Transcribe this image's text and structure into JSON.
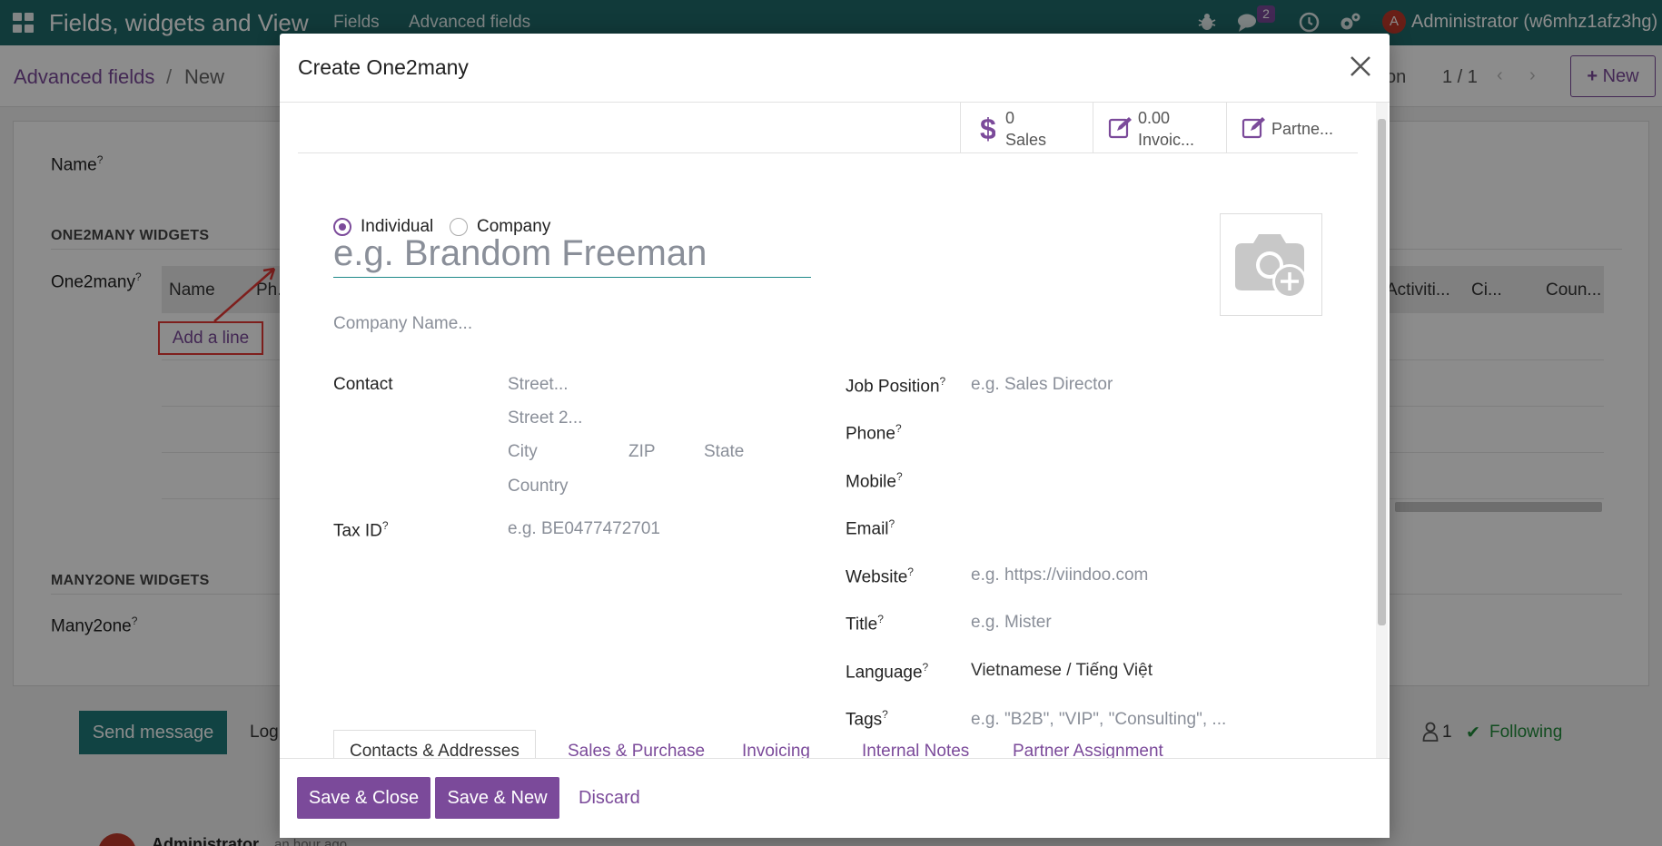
{
  "navbar": {
    "app_title": "Fields, widgets and View",
    "menu_fields": "Fields",
    "menu_advanced": "Advanced fields",
    "message_count": "2",
    "avatar_letter": "A",
    "user_name": "Administrator (w6mhz1afz3hg)"
  },
  "breadcrumb": {
    "parent": "Advanced fields",
    "separator": "/",
    "current": "New"
  },
  "control": {
    "partial_action": "on",
    "pager": "1 / 1",
    "new_label": "New"
  },
  "form": {
    "name_label": "Name",
    "one2many_section": "ONE2MANY WIDGETS",
    "one2many_label": "One2many",
    "table_headers": [
      "Name",
      "Ph..",
      "Activiti...",
      "Ci...",
      "Coun..."
    ],
    "add_line": "Add a line",
    "many2one_section": "MANY2ONE WIDGETS",
    "many2one_label": "Many2one",
    "help_mark": "?"
  },
  "chatter": {
    "send_message": "Send message",
    "log_note": "Log",
    "followers_count": "1",
    "following": "Following",
    "author": "Administrator",
    "time": "an hour ago"
  },
  "modal": {
    "title": "Create One2many",
    "stats": [
      {
        "icon": "dollar-icon",
        "value": "0",
        "label": "Sales"
      },
      {
        "icon": "edit-icon",
        "value": "0.00",
        "label": "Invoic..."
      },
      {
        "icon": "edit-icon",
        "value": "",
        "label": "Partne..."
      }
    ],
    "company_type": {
      "individual": "Individual",
      "company": "Company",
      "selected": "Individual"
    },
    "name_placeholder": "e.g. Brandom Freeman",
    "company_name_placeholder": "Company Name...",
    "left_fields": {
      "contact_label": "Contact",
      "street_ph": "Street...",
      "street2_ph": "Street 2...",
      "city_ph": "City",
      "zip_ph": "ZIP",
      "state_ph": "State",
      "country_ph": "Country",
      "tax_label": "Tax ID",
      "tax_ph": "e.g. BE0477472701"
    },
    "right_fields": {
      "job_label": "Job Position",
      "job_ph": "e.g. Sales Director",
      "phone_label": "Phone",
      "mobile_label": "Mobile",
      "email_label": "Email",
      "website_label": "Website",
      "website_ph": "e.g. https://viindoo.com",
      "title_label": "Title",
      "title_ph": "e.g. Mister",
      "language_label": "Language",
      "language_value": "Vietnamese / Tiếng Việt",
      "tags_label": "Tags",
      "tags_ph": "e.g. \"B2B\", \"VIP\", \"Consulting\", ..."
    },
    "tabs": [
      "Contacts & Addresses",
      "Sales & Purchase",
      "Invoicing",
      "Internal Notes",
      "Partner Assignment"
    ],
    "footer": {
      "save_close": "Save & Close",
      "save_new": "Save & New",
      "discard": "Discard"
    }
  },
  "colors": {
    "navbar": "#1f6b6b",
    "primary": "#7b4a9a",
    "focus_underline": "#1f8a8a",
    "annotation": "#e53935"
  }
}
